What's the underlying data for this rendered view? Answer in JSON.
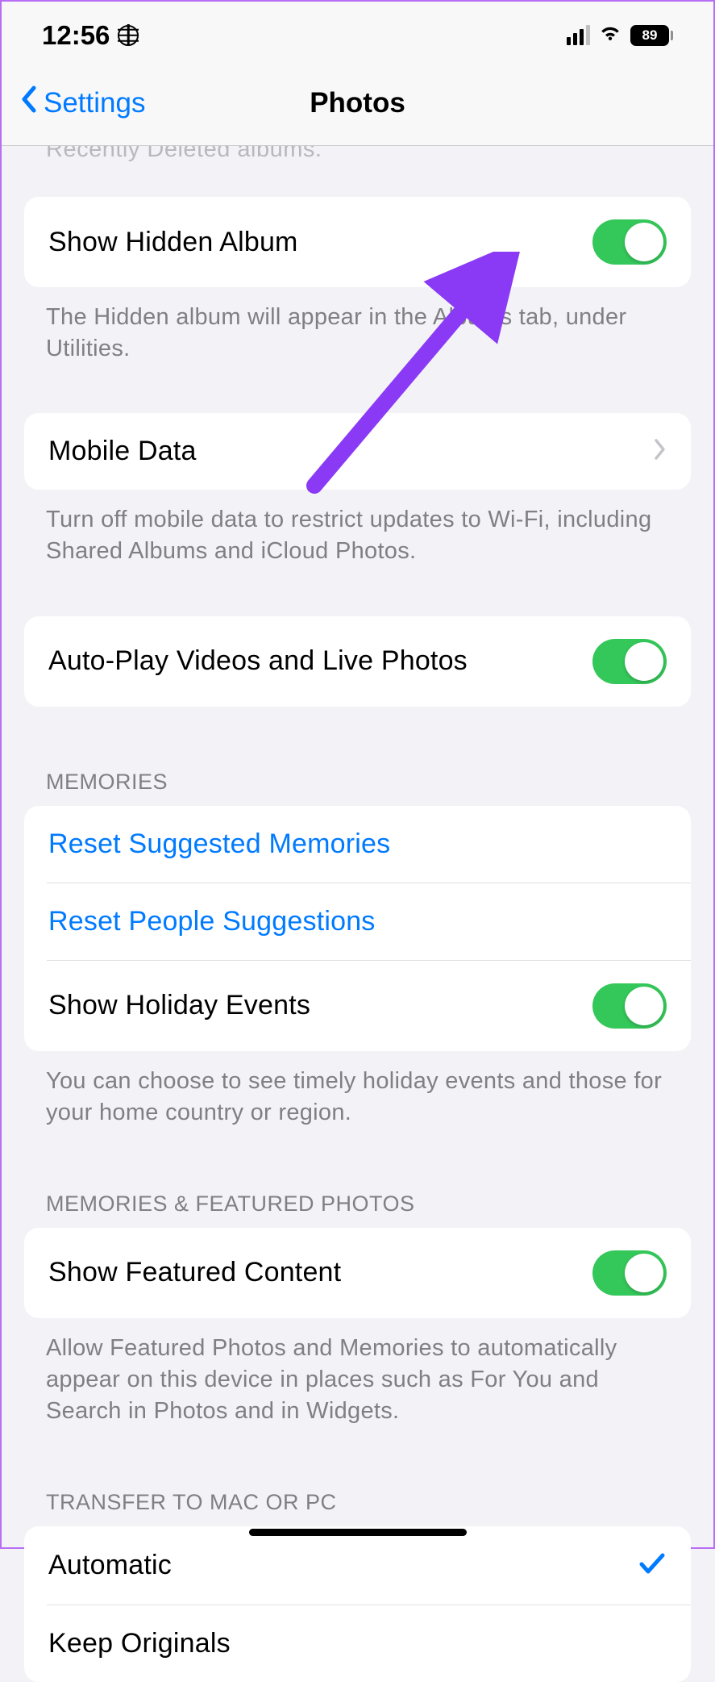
{
  "status": {
    "time": "12:56",
    "battery": "89"
  },
  "nav": {
    "back": "Settings",
    "title": "Photos"
  },
  "cutoff": "Recently Deleted albums.",
  "rows": {
    "showHidden": {
      "label": "Show Hidden Album",
      "footer": "The Hidden album will appear in the Albums tab, under Utilities."
    },
    "mobileData": {
      "label": "Mobile Data",
      "footer": "Turn off mobile data to restrict updates to Wi-Fi, including Shared Albums and iCloud Photos."
    },
    "autoPlay": {
      "label": "Auto-Play Videos and Live Photos"
    }
  },
  "memories": {
    "header": "MEMORIES",
    "resetMemories": "Reset Suggested Memories",
    "resetPeople": "Reset People Suggestions",
    "showHoliday": "Show Holiday Events",
    "footer": "You can choose to see timely holiday events and those for your home country or region."
  },
  "featured": {
    "header": "MEMORIES & FEATURED PHOTOS",
    "label": "Show Featured Content",
    "footer": "Allow Featured Photos and Memories to automatically appear on this device in places such as For You and Search in Photos and in Widgets."
  },
  "transfer": {
    "header": "TRANSFER TO MAC OR PC",
    "automatic": "Automatic",
    "keepOriginals": "Keep Originals"
  }
}
